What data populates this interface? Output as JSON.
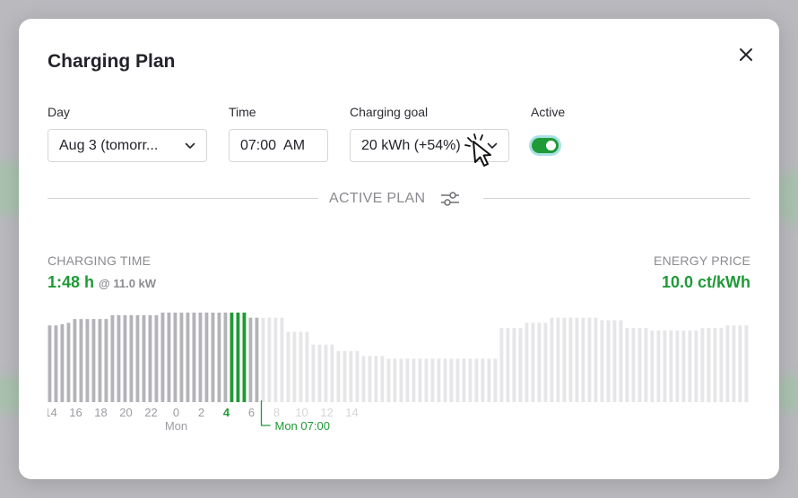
{
  "modal": {
    "title": "Charging Plan",
    "fields": {
      "day": {
        "label": "Day",
        "value": "Aug 3 (tomorr..."
      },
      "time": {
        "label": "Time",
        "value": "07:00  AM"
      },
      "goal": {
        "label": "Charging goal",
        "value": "20 kWh (+54%)"
      },
      "active": {
        "label": "Active",
        "on": true
      }
    },
    "section_label": "ACTIVE PLAN",
    "stats": {
      "charging_time_label": "CHARGING TIME",
      "charging_time_value": "1:48 h",
      "charging_power": "@ 11.0 kW",
      "energy_price_label": "ENERGY PRICE",
      "energy_price_value": "10.0 ct/kWh"
    }
  },
  "icons": {
    "close": "close-icon",
    "chevron": "chevron-down-icon",
    "plan_settings": "sliders-icon",
    "cursor": "pointer-cursor-icon"
  },
  "colors": {
    "accent_green": "#1f9a36",
    "bar_past": "#b3b3b9",
    "bar_future": "#e6e6e9",
    "text_muted": "#8b8b90"
  },
  "chart_data": {
    "type": "bar",
    "x_tick_labels": [
      "14",
      "16",
      "18",
      "20",
      "22",
      "0",
      "2",
      "4",
      "6",
      "8",
      "10",
      "12",
      "14"
    ],
    "x_sublabel": "Mon",
    "marker_label": "Mon 07:00",
    "values": [
      60,
      60,
      60,
      60,
      60,
      62,
      62,
      62,
      65,
      65,
      65,
      65,
      65,
      65,
      65,
      65,
      65,
      65,
      65,
      65,
      68,
      68,
      68,
      68,
      68,
      68,
      68,
      68,
      68,
      68,
      68,
      68,
      68,
      68,
      68,
      68,
      70,
      70,
      70,
      70,
      70,
      70,
      70,
      70,
      70,
      70,
      70,
      70,
      70,
      70,
      70,
      70,
      70,
      70,
      70,
      70,
      70,
      70,
      70,
      70,
      70,
      70,
      70,
      70,
      66,
      66,
      66,
      66,
      66,
      66,
      66,
      66,
      66,
      66,
      66,
      66,
      55,
      55,
      55,
      55,
      55,
      55,
      55,
      55,
      45,
      45,
      45,
      45,
      45,
      45,
      45,
      45,
      40,
      40,
      40,
      40,
      40,
      40,
      40,
      40,
      36,
      36,
      36,
      36,
      36,
      36,
      36,
      36,
      34,
      34,
      34,
      34,
      34,
      34,
      34,
      34,
      34,
      34,
      34,
      34,
      34,
      34,
      34,
      34,
      34,
      34,
      34,
      34,
      34,
      34,
      34,
      34,
      34,
      34,
      34,
      34,
      34,
      34,
      34,
      34,
      34,
      34,
      34,
      34,
      58,
      58,
      58,
      58,
      58,
      58,
      58,
      58,
      62,
      62,
      62,
      62,
      62,
      62,
      62,
      62,
      66,
      66,
      66,
      66,
      66,
      66,
      66,
      66,
      66,
      66,
      66,
      66,
      66,
      66,
      66,
      66,
      64,
      64,
      64,
      64,
      64,
      64,
      64,
      64,
      58,
      58,
      58,
      58,
      58,
      58,
      58,
      58,
      56,
      56,
      56,
      56,
      56,
      56,
      56,
      56,
      56,
      56,
      56,
      56,
      56,
      56,
      56,
      56,
      58,
      58,
      58,
      58,
      58,
      58,
      58,
      58,
      60,
      60,
      60,
      60,
      60,
      60,
      60,
      60
    ],
    "charging_hours": [
      "04:00",
      "05:45"
    ],
    "series": [
      {
        "name": "past",
        "color": "#b3b3b9"
      },
      {
        "name": "charging",
        "color": "#1f9a36"
      },
      {
        "name": "future",
        "color": "#e6e6e9"
      }
    ]
  }
}
